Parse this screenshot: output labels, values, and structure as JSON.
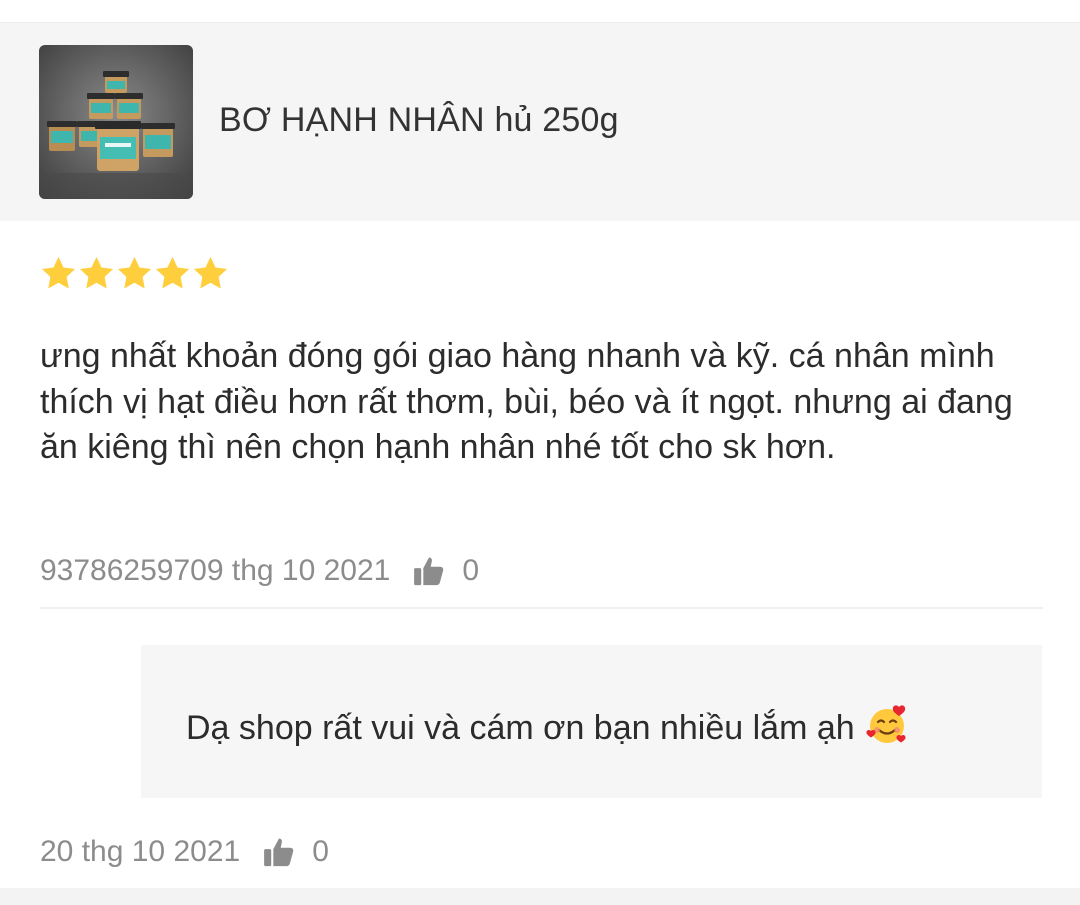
{
  "product": {
    "title": "BƠ HẠNH NHÂN hủ 250g",
    "thumbnail_icon": "product-jars-photo"
  },
  "review": {
    "rating": 5,
    "rating_max": 5,
    "star_color": "#FFCE3D",
    "text": "ưng nhất khoản đóng gói giao hàng nhanh và kỹ. cá nhân mình thích vị hạt điều hơn rất thơm, bùi, béo và ít ngọt. nhưng ai đang ăn kiêng thì nên chọn hạnh nhân nhé tốt cho sk hơn.",
    "meta": "93786259709 thg 10 2021",
    "like_count": "0",
    "like_icon": "thumbs-up-icon"
  },
  "reply": {
    "text": "Dạ shop rất vui và cám ơn bạn nhiều lắm ạh",
    "emoji": "smiling-face-with-hearts",
    "date": "20 thg 10 2021",
    "like_count": "0",
    "like_icon": "thumbs-up-icon"
  }
}
